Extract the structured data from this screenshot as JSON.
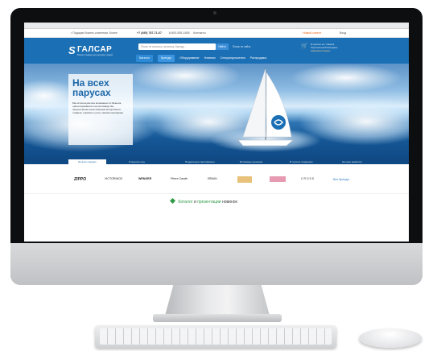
{
  "menubar": {
    "left": "",
    "right": ""
  },
  "topbar": {
    "tagline": "• Подарки бизнес-клиентам, более",
    "phone": "+7 (495) 787-71-67",
    "phone2": "8-800-555-1655",
    "contacts": "Контакты",
    "new_client": "Новый клиент",
    "login": "Вход"
  },
  "header": {
    "logo_mark": "S",
    "logo_text": "ГАЛСАР",
    "logo_sub": "Бизнес-подарки для деловых людей",
    "search_placeholder": "Поиск по каталогу, артикулу, бренду...",
    "search_button": "Найти",
    "search_link": "Поиск по сайту",
    "cart_line1": "В корзине нет товаров",
    "cart_line2": "Персональный менеджер",
    "cart_line3": "Анастасия Черных"
  },
  "nav": [
    "Каталог",
    "Бренды",
    "Оборудование",
    "Новинки",
    "Спецпредложения",
    "Распродажа"
  ],
  "hero": {
    "title": "На всех парусах",
    "subtitle": "Мы используем все возможности бизнеса, ориентированного на производство, предоставляя качественный ассортимент товаров, сервиса и услуг нашим партнёрам"
  },
  "hero_tabs": [
    "На всех парусах",
    "Открытие шоу",
    "Подарочные сертификаты",
    "Бутиковые решения",
    "В лучших традициях",
    "На пике развития"
  ],
  "brands": [
    "ZIPPO",
    "VICTORINOX",
    "WENGER",
    "Pierre Cardin",
    "ERMAN",
    "·",
    "·",
    "CROSS",
    "Все бренды"
  ],
  "catalog": {
    "part1": "Каталог",
    "and": "и",
    "part2": "презентации",
    "part3": "новинок"
  }
}
